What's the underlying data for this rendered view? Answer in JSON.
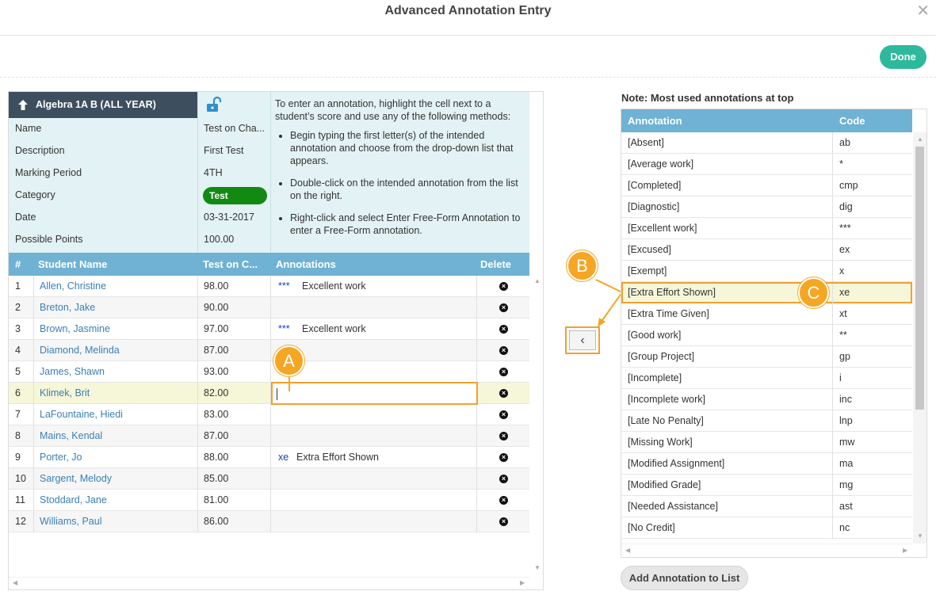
{
  "dialog": {
    "title": "Advanced Annotation Entry",
    "close_icon": "close-icon",
    "done_label": "Done"
  },
  "info": {
    "course": "Algebra 1A B (ALL YEAR)",
    "labels": [
      "Name",
      "Description",
      "Marking Period",
      "Category",
      "Date",
      "Possible Points"
    ],
    "values": {
      "name": "Test on Cha...",
      "description": "First Test",
      "marking_period": "4TH",
      "category": "Test",
      "date": "03-31-2017",
      "possible_points": "100.00"
    },
    "category_color": "#128a12"
  },
  "instructions": {
    "intro": "To enter an annotation, highlight the cell next to a student’s score and use any of the following methods:",
    "bullets": [
      "Begin typing the first letter(s) of the intended annotation and choose from the drop-down list that appears.",
      "Double-click on the intended annotation from the list on the right.",
      "Right-click and select Enter Free-Form Annotation to enter a Free-Form annotation."
    ]
  },
  "grid": {
    "headers": {
      "num": "#",
      "student": "Student Name",
      "test": "Test on C...",
      "annotations": "Annotations",
      "delete": "Delete"
    },
    "rows": [
      {
        "num": "1",
        "name": "Allen, Christine",
        "score": "98.00",
        "code": "***",
        "annotation": "Excellent work"
      },
      {
        "num": "2",
        "name": "Breton, Jake",
        "score": "90.00",
        "code": "",
        "annotation": ""
      },
      {
        "num": "3",
        "name": "Brown, Jasmine",
        "score": "97.00",
        "code": "***",
        "annotation": "Excellent work"
      },
      {
        "num": "4",
        "name": "Diamond, Melinda",
        "score": "87.00",
        "code": "",
        "annotation": ""
      },
      {
        "num": "5",
        "name": "James, Shawn",
        "score": "93.00",
        "code": "",
        "annotation": ""
      },
      {
        "num": "6",
        "name": "Klimek, Brit",
        "score": "82.00",
        "code": "",
        "annotation": ""
      },
      {
        "num": "7",
        "name": "LaFountaine, Hiedi",
        "score": "83.00",
        "code": "",
        "annotation": ""
      },
      {
        "num": "8",
        "name": "Mains, Kendal",
        "score": "87.00",
        "code": "",
        "annotation": ""
      },
      {
        "num": "9",
        "name": "Porter, Jo",
        "score": "88.00",
        "code": "xe",
        "annotation": "Extra Effort Shown"
      },
      {
        "num": "10",
        "name": "Sargent, Melody",
        "score": "85.00",
        "code": "",
        "annotation": ""
      },
      {
        "num": "11",
        "name": "Stoddard, Jane",
        "score": "81.00",
        "code": "",
        "annotation": ""
      },
      {
        "num": "12",
        "name": "Williams, Paul",
        "score": "86.00",
        "code": "",
        "annotation": ""
      }
    ]
  },
  "callouts": {
    "a": "A",
    "b": "B",
    "c": "C",
    "color": "#f5a623"
  },
  "move_button": {
    "icon": "chevron-left-icon",
    "glyph": "‹"
  },
  "annotations_list": {
    "note": "Note: Most used annotations at top",
    "headers": {
      "annotation": "Annotation",
      "code": "Code"
    },
    "rows": [
      {
        "annotation": "[Absent]",
        "code": "ab"
      },
      {
        "annotation": "[Average work]",
        "code": "*"
      },
      {
        "annotation": "[Completed]",
        "code": "cmp"
      },
      {
        "annotation": "[Diagnostic]",
        "code": "dig"
      },
      {
        "annotation": "[Excellent work]",
        "code": "***"
      },
      {
        "annotation": "[Excused]",
        "code": "ex"
      },
      {
        "annotation": "[Exempt]",
        "code": "x"
      },
      {
        "annotation": "[Extra Effort Shown]",
        "code": "xe"
      },
      {
        "annotation": "[Extra Time Given]",
        "code": "xt"
      },
      {
        "annotation": "[Good work]",
        "code": "**"
      },
      {
        "annotation": "[Group Project]",
        "code": "gp"
      },
      {
        "annotation": "[Incomplete]",
        "code": "i"
      },
      {
        "annotation": "[Incomplete work]",
        "code": "inc"
      },
      {
        "annotation": "[Late No Penalty]",
        "code": "lnp"
      },
      {
        "annotation": "[Missing Work]",
        "code": "mw"
      },
      {
        "annotation": "[Modified Assignment]",
        "code": "ma"
      },
      {
        "annotation": "[Modified Grade]",
        "code": "mg"
      },
      {
        "annotation": "[Needed Assistance]",
        "code": "ast"
      },
      {
        "annotation": "[No Credit]",
        "code": "nc"
      }
    ],
    "add_label": "Add Annotation to List"
  }
}
